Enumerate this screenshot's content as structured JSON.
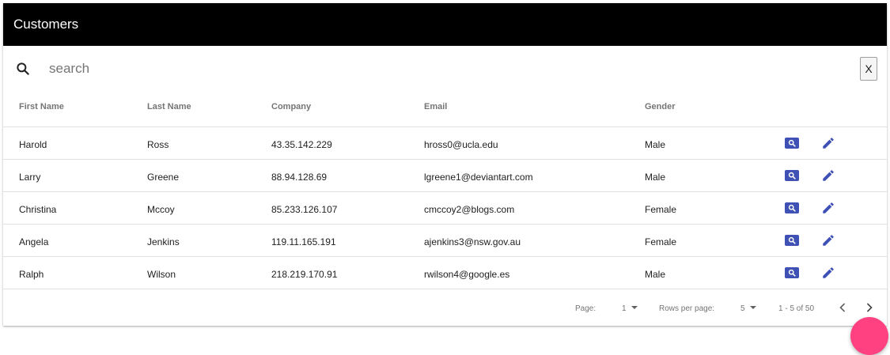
{
  "header": {
    "title": "Customers"
  },
  "search": {
    "placeholder": "search",
    "value": "",
    "clear_label": "X"
  },
  "table": {
    "columns": [
      "First Name",
      "Last Name",
      "Company",
      "Email",
      "Gender"
    ],
    "rows": [
      [
        "Harold",
        "Ross",
        "43.35.142.229",
        "hross0@ucla.edu",
        "Male"
      ],
      [
        "Larry",
        "Greene",
        "88.94.128.69",
        "lgreene1@deviantart.com",
        "Male"
      ],
      [
        "Christina",
        "Mccoy",
        "85.233.126.107",
        "cmccoy2@blogs.com",
        "Female"
      ],
      [
        "Angela",
        "Jenkins",
        "119.11.165.191",
        "ajenkins3@nsw.gov.au",
        "Female"
      ],
      [
        "Ralph",
        "Wilson",
        "218.219.170.91",
        "rwilson4@google.es",
        "Male"
      ]
    ],
    "row_actions": [
      "search-icon",
      "pencil-icon"
    ]
  },
  "pagination": {
    "page_label": "Page:",
    "page_value": "1",
    "rows_per_page_label": "Rows per page:",
    "rows_per_page_value": "5",
    "range_text": "1 - 5 of 50"
  },
  "colors": {
    "header_bg": "#000000",
    "action_primary": "#3f51b5",
    "fab": "#ff4081"
  },
  "icons": {
    "search": "search-icon",
    "prev": "chevron-left-icon",
    "next": "chevron-right-icon",
    "caret": "caret-down-icon"
  }
}
